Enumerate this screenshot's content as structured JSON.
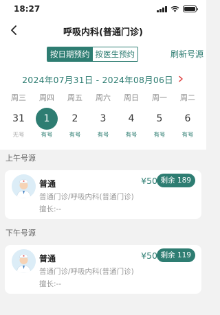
{
  "status_bar": {
    "time": "18:27"
  },
  "nav": {
    "title": "呼吸内科(普通门诊)"
  },
  "tabs": {
    "items": [
      {
        "label": "按日期预约",
        "active": true
      },
      {
        "label": "按医生预约",
        "active": false
      }
    ],
    "refresh_label": "刷新号源"
  },
  "date_range": {
    "text": "2024年07月31日 - 2024年08月06日"
  },
  "week": [
    {
      "weekday": "周三",
      "day": "31",
      "status": "无号",
      "available": false,
      "selected": false
    },
    {
      "weekday": "周四",
      "day": "1",
      "status": "有号",
      "available": true,
      "selected": true
    },
    {
      "weekday": "周五",
      "day": "2",
      "status": "有号",
      "available": true,
      "selected": false
    },
    {
      "weekday": "周六",
      "day": "3",
      "status": "有号",
      "available": true,
      "selected": false
    },
    {
      "weekday": "周日",
      "day": "4",
      "status": "有号",
      "available": true,
      "selected": false
    },
    {
      "weekday": "周一",
      "day": "5",
      "status": "有号",
      "available": true,
      "selected": false
    },
    {
      "weekday": "周二",
      "day": "6",
      "status": "有号",
      "available": true,
      "selected": false
    }
  ],
  "sessions": [
    {
      "label": "上午号源",
      "card": {
        "doctor": "普通",
        "price": "¥50",
        "remaining": "剩余 189",
        "department": "普通门诊/呼吸内科(普通门诊)",
        "speciality": "擅长:--"
      }
    },
    {
      "label": "下午号源",
      "card": {
        "doctor": "普通",
        "price": "¥50",
        "remaining": "剩余 119",
        "department": "普通门诊/呼吸内科(普通门诊)",
        "speciality": "擅长:--"
      }
    }
  ],
  "colors": {
    "accent": "#2e7d72",
    "background": "#f2f2f2",
    "muted_text": "#999999",
    "red_chevron": "#e04b4b"
  },
  "icons": {
    "back": "chevron-left-icon",
    "next_week": "chevron-right-icon",
    "avatar": "doctor-avatar-icon"
  }
}
